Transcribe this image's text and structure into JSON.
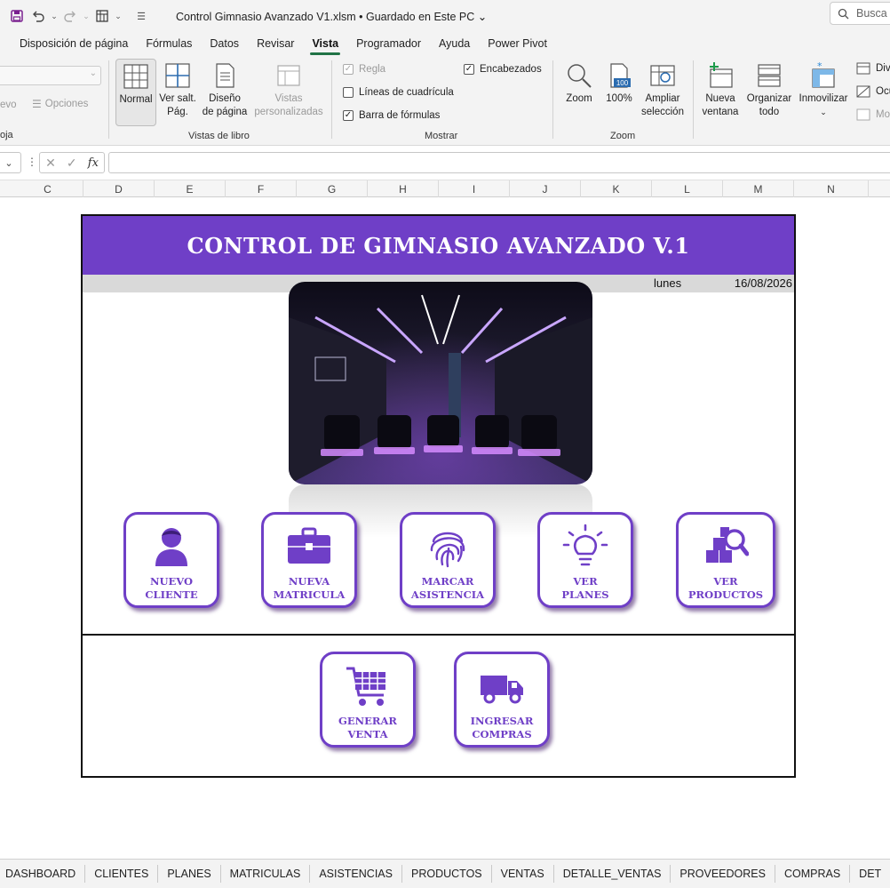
{
  "window": {
    "title": "Control Gimnasio Avanzado V1.xlsm",
    "save_status": "Guardado en Este PC",
    "search_placeholder": "Busca"
  },
  "ribbon_tabs": [
    {
      "label": "Disposición de página"
    },
    {
      "label": "Fórmulas"
    },
    {
      "label": "Datos"
    },
    {
      "label": "Revisar"
    },
    {
      "label": "Vista",
      "active": true
    },
    {
      "label": "Programador"
    },
    {
      "label": "Ayuda"
    },
    {
      "label": "Power Pivot"
    }
  ],
  "ribbon": {
    "hoja": {
      "new_label": "evo",
      "options_label": "Opciones",
      "group": "oja"
    },
    "vistas_libro": {
      "normal": "Normal",
      "ver_salt_1": "Ver salt.",
      "ver_salt_2": "Pág.",
      "diseno_1": "Diseño",
      "diseno_2": "de página",
      "vistas_1": "Vistas",
      "vistas_2": "personalizadas",
      "group": "Vistas de libro"
    },
    "mostrar": {
      "regla": "Regla",
      "lineas": "Líneas de cuadrícula",
      "barra": "Barra de fórmulas",
      "encabezados": "Encabezados",
      "group": "Mostrar"
    },
    "zoom": {
      "zoom": "Zoom",
      "pct": "100%",
      "icon_pct": "100",
      "ampliar_1": "Ampliar",
      "ampliar_2": "selección",
      "group": "Zoom"
    },
    "ventana": {
      "nueva_1": "Nueva",
      "nueva_2": "ventana",
      "organizar_1": "Organizar",
      "organizar_2": "todo",
      "inmovilizar": "Inmovilizar",
      "dividir": "Div",
      "ocultar": "Ocu",
      "mostrar": "Mo"
    }
  },
  "formula_bar": {
    "fx": "fx",
    "cancel": "✕",
    "enter": "✓"
  },
  "columns": [
    "C",
    "D",
    "E",
    "F",
    "G",
    "H",
    "I",
    "J",
    "K",
    "L",
    "M",
    "N"
  ],
  "dashboard": {
    "title": "CONTROL DE GIMNASIO AVANZADO V.1",
    "day": "lunes",
    "date": "16/08/2026",
    "tiles": [
      {
        "label": "NUEVO\nCLIENTE",
        "icon": "user-icon"
      },
      {
        "label": "NUEVA\nMATRICULA",
        "icon": "briefcase-icon"
      },
      {
        "label": "MARCAR\nASISTENCIA",
        "icon": "fingerprint-icon"
      },
      {
        "label": "VER\nPLANES",
        "icon": "lightbulb-icon"
      },
      {
        "label": "VER\nPRODUCTOS",
        "icon": "products-search-icon"
      },
      {
        "label": "GENERAR\nVENTA",
        "icon": "shopping-cart-icon"
      },
      {
        "label": "INGRESAR\nCOMPRAS",
        "icon": "truck-icon"
      }
    ],
    "accent": "#6f3fc7"
  },
  "sheet_tabs": [
    "DASHBOARD",
    "CLIENTES",
    "PLANES",
    "MATRICULAS",
    "ASISTENCIAS",
    "PRODUCTOS",
    "VENTAS",
    "DETALLE_VENTAS",
    "PROVEEDORES",
    "COMPRAS",
    "DET"
  ]
}
